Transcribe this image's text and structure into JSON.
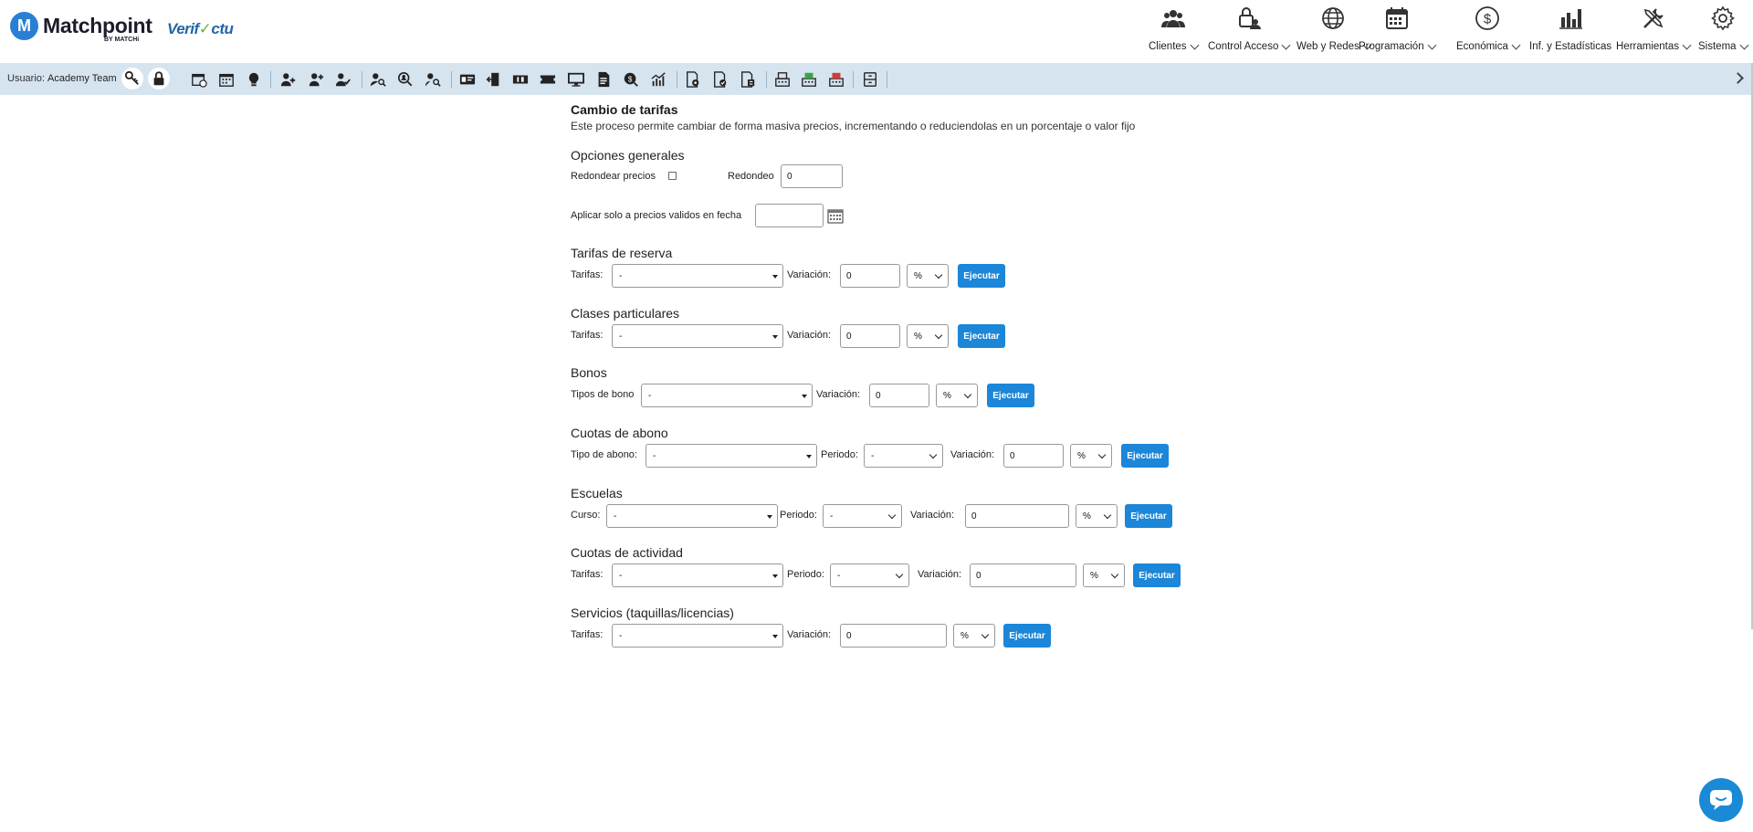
{
  "header": {
    "logo_badge": "M",
    "logo_text": "Matchpoint",
    "logo_sub": "BY MATCHi",
    "verifactu_a": "Verif",
    "verifactu_b": "ctu",
    "nav": [
      {
        "label": "Clientes",
        "icon": "users-icon"
      },
      {
        "label": "Control Acceso",
        "icon": "access-control-icon"
      },
      {
        "label": "Web y Redes",
        "icon": "globe-icon"
      },
      {
        "label": "Programación",
        "icon": "calendar-icon"
      },
      {
        "label": "Económica",
        "icon": "dollar-icon"
      },
      {
        "label": "Inf. y Estadísticas",
        "icon": "bar-chart-icon"
      },
      {
        "label": "Herramientas",
        "icon": "tools-icon"
      },
      {
        "label": "Sistema",
        "icon": "gear-icon"
      }
    ]
  },
  "toolbar": {
    "user_label": "Usuario:",
    "user_name": "Academy Team"
  },
  "page": {
    "title": "Cambio de tarifas",
    "description": "Este proceso permite cambiar de forma masiva precios, incrementando o reduciendolas en un porcentaje o valor fijo"
  },
  "general": {
    "title": "Opciones generales",
    "round_label": "Redondear precios",
    "redondeo_label": "Redondeo",
    "redondeo_value": "0",
    "date_label": "Aplicar solo a precios validos en fecha",
    "date_value": ""
  },
  "sections": {
    "reserva": {
      "title": "Tarifas de reserva",
      "select_label": "Tarifas:",
      "select_value": "-",
      "var_label": "Variación:",
      "var_value": "0",
      "unit": "%",
      "button": "Ejecutar"
    },
    "clases": {
      "title": "Clases particulares",
      "select_label": "Tarifas:",
      "select_value": "-",
      "var_label": "Variación:",
      "var_value": "0",
      "unit": "%",
      "button": "Ejecutar"
    },
    "bonos": {
      "title": "Bonos",
      "select_label": "Tipos de bono",
      "select_value": "-",
      "var_label": "Variación:",
      "var_value": "0",
      "unit": "%",
      "button": "Ejecutar"
    },
    "abono": {
      "title": "Cuotas de abono",
      "select_label": "Tipo de abono:",
      "select_value": "-",
      "period_label": "Periodo:",
      "period_value": "-",
      "var_label": "Variación:",
      "var_value": "0",
      "unit": "%",
      "button": "Ejecutar"
    },
    "escuelas": {
      "title": "Escuelas",
      "select_label": "Curso:",
      "select_value": "-",
      "period_label": "Periodo:",
      "period_value": "-",
      "var_label": "Variación:",
      "var_value": "0",
      "unit": "%",
      "button": "Ejecutar"
    },
    "actividad": {
      "title": "Cuotas de actividad",
      "select_label": "Tarifas:",
      "select_value": "-",
      "period_label": "Periodo:",
      "period_value": "-",
      "var_label": "Variación:",
      "var_value": "0",
      "unit": "%",
      "button": "Ejecutar"
    },
    "servicios": {
      "title": "Servicios (taquillas/licencias)",
      "select_label": "Tarifas:",
      "select_value": "-",
      "var_label": "Variación:",
      "var_value": "0",
      "unit": "%",
      "button": "Ejecutar"
    }
  },
  "colors": {
    "accent": "#1c86d8",
    "toolbar_bg": "#d6e4f0",
    "logo": "#2a7fd4"
  }
}
